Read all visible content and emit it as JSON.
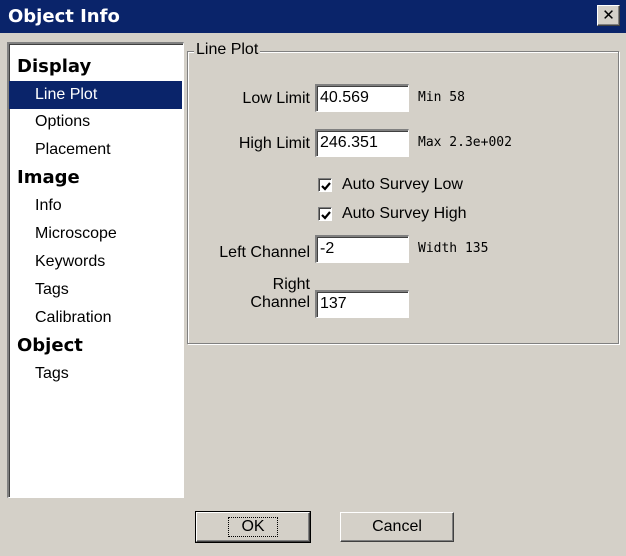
{
  "window": {
    "title": "Object Info",
    "close_glyph": "✕"
  },
  "sidebar": {
    "categories": [
      {
        "label": "Display",
        "items": [
          "Line Plot",
          "Options",
          "Placement"
        ]
      },
      {
        "label": "Image",
        "items": [
          "Info",
          "Microscope",
          "Keywords",
          "Tags",
          "Calibration"
        ]
      },
      {
        "label": "Object",
        "items": [
          "Tags"
        ]
      }
    ],
    "selected": "Line Plot"
  },
  "line_plot": {
    "group_label": "Line Plot",
    "low_limit": {
      "label": "Low Limit",
      "value": "40.569",
      "info": "Min 58"
    },
    "high_limit": {
      "label": "High Limit",
      "value": "246.351",
      "info": "Max 2.3e+002"
    },
    "auto_survey_low": {
      "label": "Auto Survey Low",
      "checked": true
    },
    "auto_survey_high": {
      "label": "Auto Survey High",
      "checked": true
    },
    "left_channel": {
      "label": "Left Channel",
      "value": "-2",
      "info": "Width 135"
    },
    "right_channel": {
      "label_line1": "Right",
      "label_line2": "Channel",
      "value": "137"
    }
  },
  "buttons": {
    "ok": "OK",
    "cancel": "Cancel"
  },
  "colors": {
    "titlebar": "#0a246a",
    "selection": "#0a246a",
    "face": "#d4d0c8"
  },
  "icons": {
    "close": "close-icon",
    "check": "checkmark-icon"
  }
}
